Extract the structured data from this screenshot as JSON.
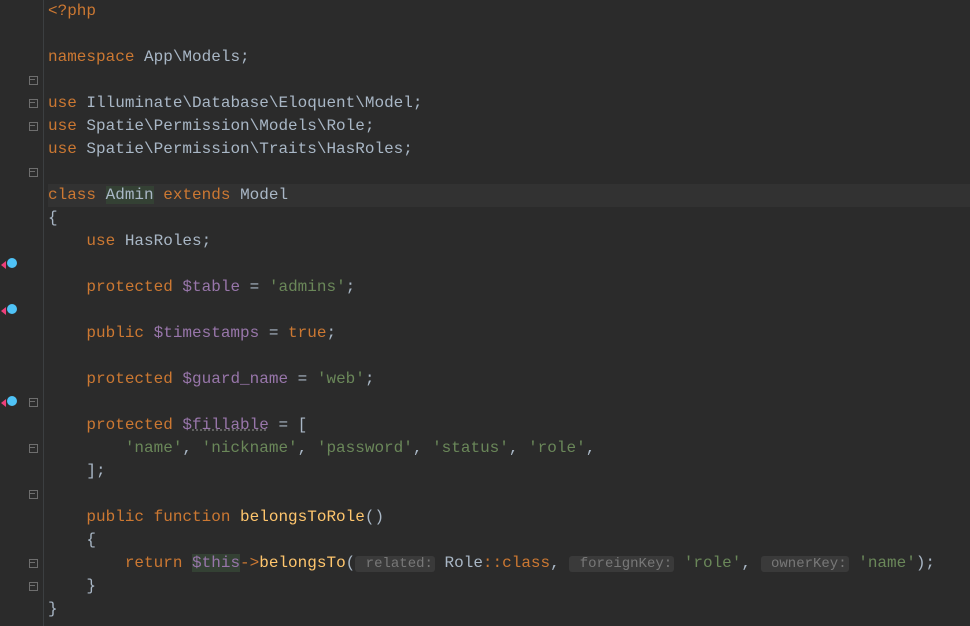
{
  "code": {
    "l1_php": "<?php",
    "l3_ns_kw": "namespace",
    "l3_ns": " App\\Models;",
    "l5_use": "use",
    "l5_path": " Illuminate\\Database\\Eloquent\\Model;",
    "l6_use": "use",
    "l6_path": " Spatie\\Permission\\Models\\Role;",
    "l7_use": "use",
    "l7_path": " Spatie\\Permission\\Traits\\HasRoles;",
    "l9_class": "class",
    "l9_name": "Admin",
    "l9_extends": "extends",
    "l9_model": " Model",
    "l10_open": "{",
    "l11_use": "use",
    "l11_trait": " HasRoles;",
    "l13_prot": "protected",
    "l13_var": " $table",
    "l13_eq": " = ",
    "l13_str": "'admins'",
    "l13_semi": ";",
    "l15_pub": "public",
    "l15_var": " $timestamps",
    "l15_eq": " = ",
    "l15_true": "true",
    "l15_semi": ";",
    "l17_prot": "protected",
    "l17_var": " $guard_name",
    "l17_eq": " = ",
    "l17_str": "'web'",
    "l17_semi": ";",
    "l19_prot": "protected",
    "l19_var_dollar": " $",
    "l19_var_name": "fillable",
    "l19_eq": " = [",
    "l20_s1": "'name'",
    "l20_c1": ", ",
    "l20_s2": "'nickname'",
    "l20_c2": ", ",
    "l20_s3": "'password'",
    "l20_c3": ", ",
    "l20_s4": "'status'",
    "l20_c4": ", ",
    "l20_s5": "'role'",
    "l20_c5": ",",
    "l21_close": "];",
    "l23_pub": "public",
    "l23_func": " function",
    "l23_name": " belongsToRole",
    "l23_paren": "()",
    "l24_open": "{",
    "l25_ret": "return",
    "l25_this": "$this",
    "l25_arrow": "->",
    "l25_method": "belongsTo",
    "l25_p1": "(",
    "l25_hint1": " related:",
    "l25_role": " Role",
    "l25_dcolon": "::",
    "l25_classkw": "class",
    "l25_c1": ", ",
    "l25_hint2": " foreignKey:",
    "l25_str1": " 'role'",
    "l25_c2": ", ",
    "l25_hint3": " ownerKey:",
    "l25_str2": " 'name'",
    "l25_p2": ");",
    "l26_close": "}",
    "l27_close": "}"
  }
}
